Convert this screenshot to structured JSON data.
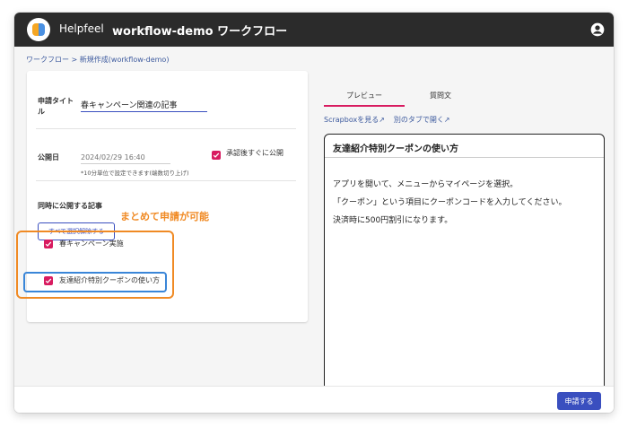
{
  "header": {
    "brand": "Helpfeel",
    "title": "workflow-demo ワークフロー",
    "user_icon": "account-circle-icon"
  },
  "breadcrumb": {
    "parent": "ワークフロー",
    "separator": " > ",
    "current": "新規作成(workflow-demo)"
  },
  "form": {
    "title_label": "申請タイトル",
    "title_value": "春キャンペーン関連の記事",
    "date_label": "公開日",
    "date_placeholder": "2024/02/29 16:40",
    "date_hint": "*10分単位で設定できます(端数切り上げ)",
    "approve_label": "承認後すぐに公開",
    "approve_checked": true,
    "related_label": "同時に公開する記事",
    "deselect_button": "すべて選択解除する",
    "articles": [
      {
        "label": "春キャンペーン実施",
        "checked": true
      },
      {
        "label": "友達紹介特別クーポンの使い方",
        "checked": true
      }
    ]
  },
  "annotation": {
    "text": "まとめて申請が可能",
    "color": "#f08a24"
  },
  "preview_tabs": {
    "tabs": [
      {
        "label": "プレビュー",
        "active": true
      },
      {
        "label": "質問文",
        "active": false
      }
    ],
    "links": [
      "Scrapboxを見る↗",
      "別のタブで開く↗"
    ]
  },
  "preview": {
    "title": "友達紹介特別クーポンの使い方",
    "lines": [
      "アプリを開いて、メニューからマイページを選択。",
      "「クーポン」という項目にクーポンコードを入力してください。",
      "決済時に500円割引になります。"
    ]
  },
  "footer": {
    "submit_button": "申請する"
  },
  "colors": {
    "topbar": "#2b2b2b",
    "primary": "#3a4fbf",
    "checkbox": "#d81b60",
    "highlight_blue": "#3a86d8"
  }
}
